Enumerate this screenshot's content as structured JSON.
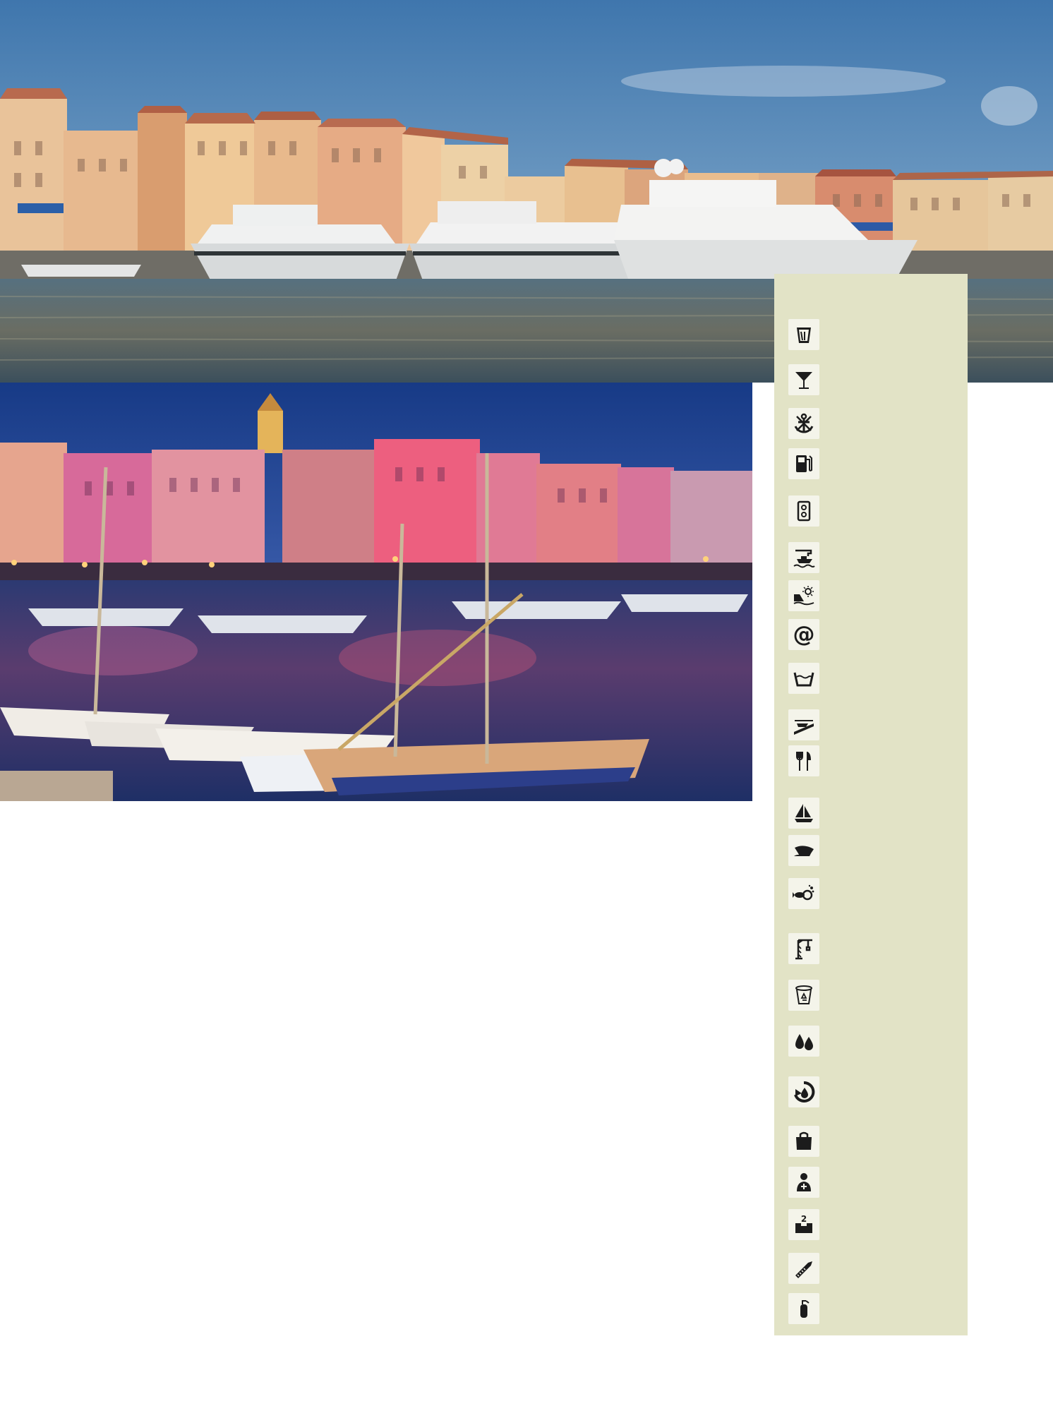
{
  "photos": {
    "top": {
      "subject": "day-harbour-yachts"
    },
    "bottom": {
      "subject": "night-harbour-boats"
    }
  },
  "amenities": {
    "background": "#e2e3c6",
    "icon_color": "#1c1c1c",
    "items": [
      {
        "name": "bar-icon"
      },
      {
        "name": "cocktail-icon"
      },
      {
        "name": "anchor-icon"
      },
      {
        "name": "fuel-pump-icon"
      },
      {
        "name": "electric-socket-icon"
      },
      {
        "name": "boat-lift-icon"
      },
      {
        "name": "beach-icon"
      },
      {
        "name": "internet-icon",
        "text": "@"
      },
      {
        "name": "laundry-icon"
      },
      {
        "name": "slipway-icon"
      },
      {
        "name": "restaurant-icon"
      },
      {
        "name": "sailing-icon"
      },
      {
        "name": "captain-hat-icon"
      },
      {
        "name": "diving-icon"
      },
      {
        "name": "crane-icon"
      },
      {
        "name": "waste-recycling-icon"
      },
      {
        "name": "water-icon"
      },
      {
        "name": "waste-oil-icon"
      },
      {
        "name": "shop-icon"
      },
      {
        "name": "harbour-master-icon"
      },
      {
        "name": "mailbox-icon",
        "text": "2"
      },
      {
        "name": "repair-saw-icon"
      },
      {
        "name": "fire-extinguisher-icon"
      }
    ]
  }
}
